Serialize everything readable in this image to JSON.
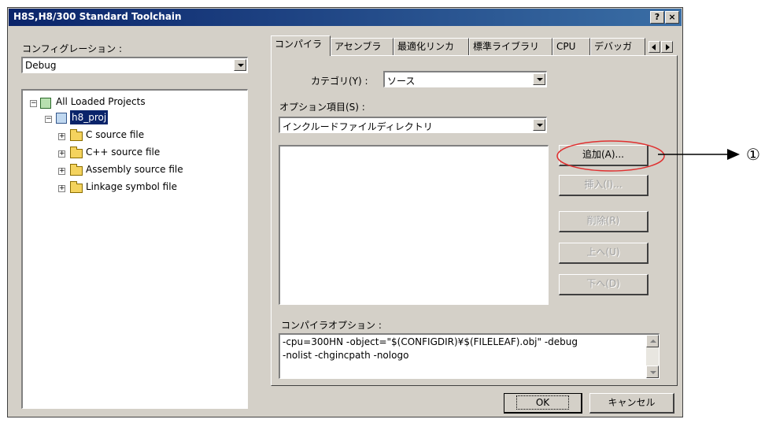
{
  "window": {
    "title": "H8S,H8/300 Standard Toolchain",
    "help_label": "?",
    "close_label": "×"
  },
  "left": {
    "config_label": "コンフィグレーション :",
    "config_value": "Debug",
    "tree": {
      "root": "All Loaded Projects",
      "project": "h8_proj",
      "folders": [
        "C source file",
        "C++ source file",
        "Assembly source file",
        "Linkage symbol file"
      ]
    }
  },
  "tabs": [
    "コンパイラ",
    "アセンブラ",
    "最適化リンカ",
    "標準ライブラリ",
    "CPU",
    "デバッガ"
  ],
  "compiler": {
    "category_label": "カテゴリ(Y) :",
    "category_value": "ソース",
    "option_label": "オプション項目(S) :",
    "option_value": "インクルードファイルディレクトリ",
    "buttons": {
      "add": "追加(A)...",
      "insert": "挿入(I)...",
      "delete": "削除(R)",
      "up": "上へ(U)",
      "down": "下へ(D)"
    },
    "compiler_options_label": "コンパイラオプション :",
    "compiler_options_line1": "-cpu=300HN -object=\"$(CONFIGDIR)¥$(FILELEAF).obj\" -debug",
    "compiler_options_line2": "-nolist -chgincpath -nologo"
  },
  "footer": {
    "ok": "OK",
    "cancel": "キャンセル"
  },
  "annotation": {
    "marker": "①",
    "highlight_color": "#e03030"
  }
}
